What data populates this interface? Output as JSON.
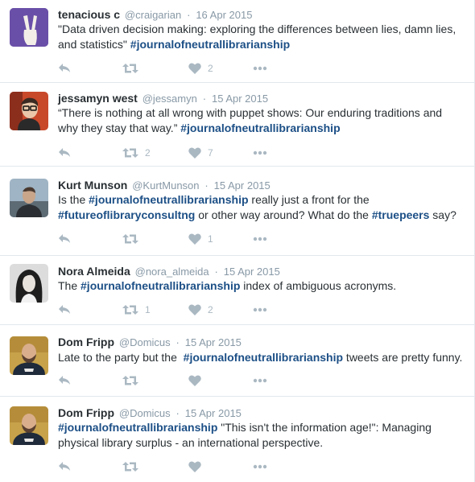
{
  "colors": {
    "hashtag": "#1c4f86",
    "meta": "#8899a6",
    "icon": "#aab8c2",
    "divider": "#e1e8ed"
  },
  "tweets": [
    {
      "name": "tenacious c",
      "username": "@craigarian",
      "sep": "·",
      "date": "16 Apr 2015",
      "segments": [
        {
          "t": "\"Data driven decision making: exploring the differences between lies, damn lies, and statistics\" "
        },
        {
          "t": "#journalofneutrallibrarianship",
          "tag": true
        }
      ],
      "retweets": "",
      "likes": "2",
      "avatar_icon": "peace-sign-hand"
    },
    {
      "name": "jessamyn west",
      "username": "@jessamyn",
      "sep": "·",
      "date": "15 Apr 2015",
      "segments": [
        {
          "t": "“There is nothing at all wrong with puppet shows: Our enduring traditions and why they stay that way.” "
        },
        {
          "t": "#journalofneutrallibrarianship",
          "tag": true
        }
      ],
      "retweets": "2",
      "likes": "7",
      "avatar_icon": "person-with-glasses"
    },
    {
      "name": "Kurt Munson",
      "username": "@KurtMunson",
      "sep": "·",
      "date": "15 Apr 2015",
      "segments": [
        {
          "t": "Is the "
        },
        {
          "t": "#journalofneutrallibrarianship",
          "tag": true
        },
        {
          "t": " really just a front for the "
        },
        {
          "t": "#futureoflibraryconsultng",
          "tag": true
        },
        {
          "t": " or other way around? What do the "
        },
        {
          "t": "#truepeers",
          "tag": true
        },
        {
          "t": " say?"
        }
      ],
      "retweets": "",
      "likes": "1",
      "avatar_icon": "person-outdoors"
    },
    {
      "name": "Nora Almeida",
      "username": "@nora_almeida",
      "sep": "·",
      "date": "15 Apr 2015",
      "segments": [
        {
          "t": "The "
        },
        {
          "t": "#journalofneutrallibrarianship",
          "tag": true
        },
        {
          "t": " index of ambiguous acronyms."
        }
      ],
      "retweets": "1",
      "likes": "2",
      "avatar_icon": "person-bw-portrait"
    },
    {
      "name": "Dom Fripp",
      "username": "@Domicus",
      "sep": "·",
      "date": "15 Apr 2015",
      "segments": [
        {
          "t": "Late to the party but the  "
        },
        {
          "t": "#journalofneutrallibrarianship",
          "tag": true
        },
        {
          "t": " tweets are pretty funny."
        }
      ],
      "retweets": "",
      "likes": "",
      "avatar_icon": "bearded-man"
    },
    {
      "name": "Dom Fripp",
      "username": "@Domicus",
      "sep": "·",
      "date": "15 Apr 2015",
      "segments": [
        {
          "t": "#journalofneutrallibrarianship",
          "tag": true
        },
        {
          "t": " \"This isn't the information age!\": Managing physical library surplus - an international perspective."
        }
      ],
      "retweets": "",
      "likes": "",
      "avatar_icon": "bearded-man"
    }
  ]
}
